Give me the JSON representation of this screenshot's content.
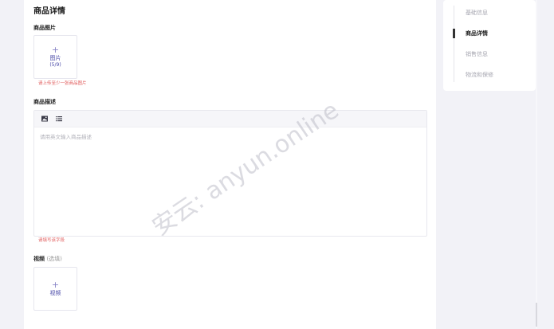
{
  "main": {
    "section_title": "商品详情",
    "images": {
      "label": "商品图片",
      "upload_label": "图片",
      "count": "(5/9)",
      "hint": "请上传至少一张商品图片"
    },
    "description": {
      "label": "商品描述",
      "placeholder": "请用英文输入商品描述",
      "hint": "请填写该字段"
    },
    "video": {
      "label": "视频",
      "optional": "(选填)",
      "upload_label": "视频"
    }
  },
  "sidebar": {
    "items": [
      {
        "label": "基础信息"
      },
      {
        "label": "商品详情"
      },
      {
        "label": "销售信息"
      },
      {
        "label": "物流和保修"
      }
    ],
    "active": "商品详情"
  },
  "watermark": "安云: anyun.online"
}
